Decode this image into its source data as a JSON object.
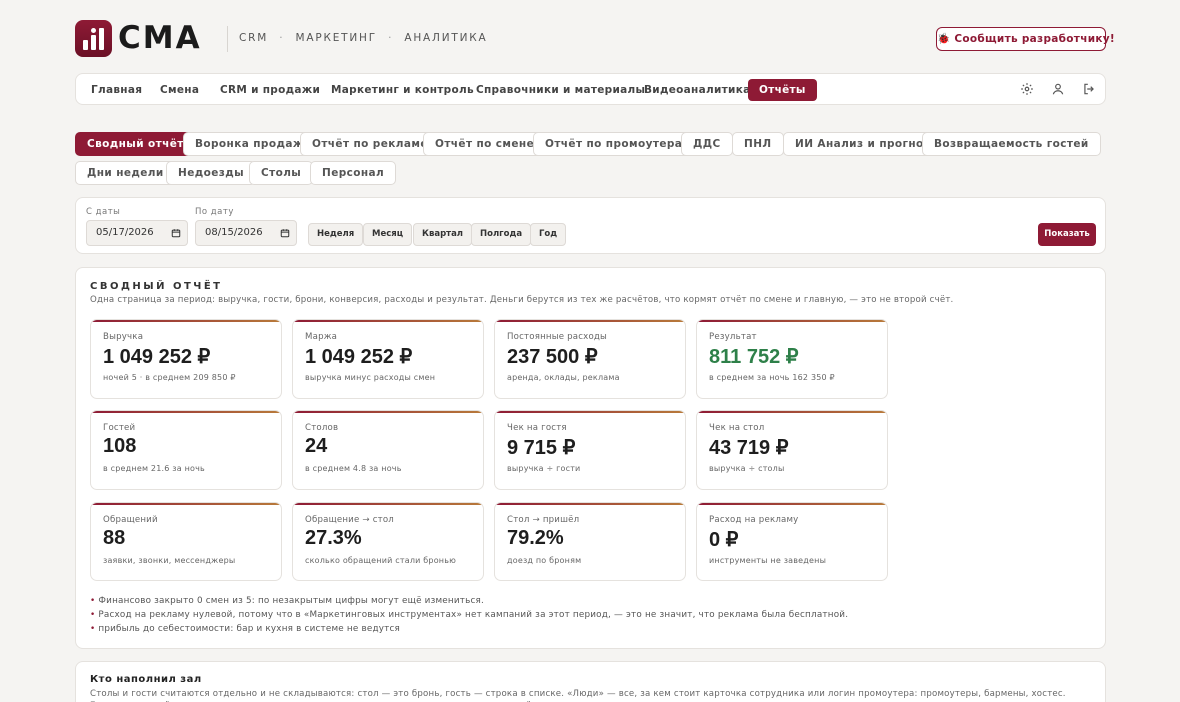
{
  "brand": {
    "name": "CMA",
    "accent": "#8e1a35",
    "positive": "#2e8049"
  },
  "header": {
    "nav": [
      "CRM",
      "МАРКЕТИНГ",
      "АНАЛИТИКА"
    ],
    "separator": "·",
    "report_icon": "bug-icon",
    "report_glyph": "🐞",
    "report_label": "Сообщить разработчику!"
  },
  "main_nav": {
    "items": [
      "Главная",
      "Смена",
      "CRM и продажи",
      "Маркетинг и контроль",
      "Справочники и материалы",
      "Видеоаналитика",
      "Отчёты"
    ],
    "active": "Отчёты",
    "icons": [
      "gear-icon",
      "user-icon",
      "logout-icon"
    ]
  },
  "report_tabs": {
    "items": [
      "Сводный отчёт",
      "Воронка продаж",
      "Отчёт по рекламе",
      "Отчёт по смене",
      "Отчёт по промоутерам",
      "ДДС",
      "ПНЛ",
      "ИИ Анализ и прогноз",
      "Возвращаемость гостей",
      "Дни недели",
      "Недоезды",
      "Столы",
      "Персонал"
    ],
    "active": "Сводный отчёт"
  },
  "filter": {
    "from_label": "С даты",
    "from_value": "05/17/2026",
    "to_label": "По дату",
    "to_value": "08/15/2026",
    "periods": [
      "Неделя",
      "Месяц",
      "Квартал",
      "Полгода",
      "Год"
    ],
    "show_label": "Показать"
  },
  "summary": {
    "title": "СВОДНЫЙ ОТЧЁТ",
    "subtitle": "Одна страница за период: выручка, гости, брони, конверсия, расходы и результат. Деньги берутся из тех же расчётов, что кормят отчёт по смене и главную, — это не второй счёт.",
    "cards": [
      {
        "label": "Выручка",
        "value": "1 049 252 ₽",
        "note": "ночей 5 · в среднем 209 850 ₽"
      },
      {
        "label": "Маржа",
        "value": "1 049 252 ₽",
        "note": "выручка минус расходы смен"
      },
      {
        "label": "Постоянные расходы",
        "value": "237 500 ₽",
        "note": "аренда, оклады, реклама"
      },
      {
        "label": "Результат",
        "value": "811 752 ₽",
        "note": "в среднем за ночь 162 350 ₽",
        "positive": true
      },
      {
        "label": "Гостей",
        "value": "108",
        "note": "в среднем 21.6 за ночь"
      },
      {
        "label": "Столов",
        "value": "24",
        "note": "в среднем 4.8 за ночь"
      },
      {
        "label": "Чек на гостя",
        "value": "9 715 ₽",
        "note": "выручка ÷ гости"
      },
      {
        "label": "Чек на стол",
        "value": "43 719 ₽",
        "note": "выручка ÷ столы"
      },
      {
        "label": "Обращений",
        "value": "88",
        "note": "заявки, звонки, мессенджеры"
      },
      {
        "label": "Обращение → стол",
        "value": "27.3%",
        "note": "сколько обращений стали бронью"
      },
      {
        "label": "Стол → пришёл",
        "value": "79.2%",
        "note": "доезд по броням"
      },
      {
        "label": "Расход на рекламу",
        "value": "0 ₽",
        "note": "инструменты не заведены"
      }
    ],
    "bullet": "•",
    "notes": [
      "Финансово закрыто 0 смен из 5: по незакрытым цифры могут ещё измениться.",
      "Расход на рекламу нулевой, потому что в «Маркетинговых инструментах» нет кампаний за этот период, — это не значит, что реклама была бесплатной.",
      "прибыль до себестоимости: бар и кухня в системе не ведутся"
    ]
  },
  "who_filled": {
    "title": "Кто наполнил зал",
    "text": "Столы и гости считаются отдельно и не складываются: стол — это бронь, гость — строка в списке. «Люди» — все, за кем стоит карточка сотрудника или логин промоутера: промоутеры, бармены, хостес. Если стол пришёл с рекламы, а позже его увели, — строка отметит источник, откуда пришёл."
  }
}
